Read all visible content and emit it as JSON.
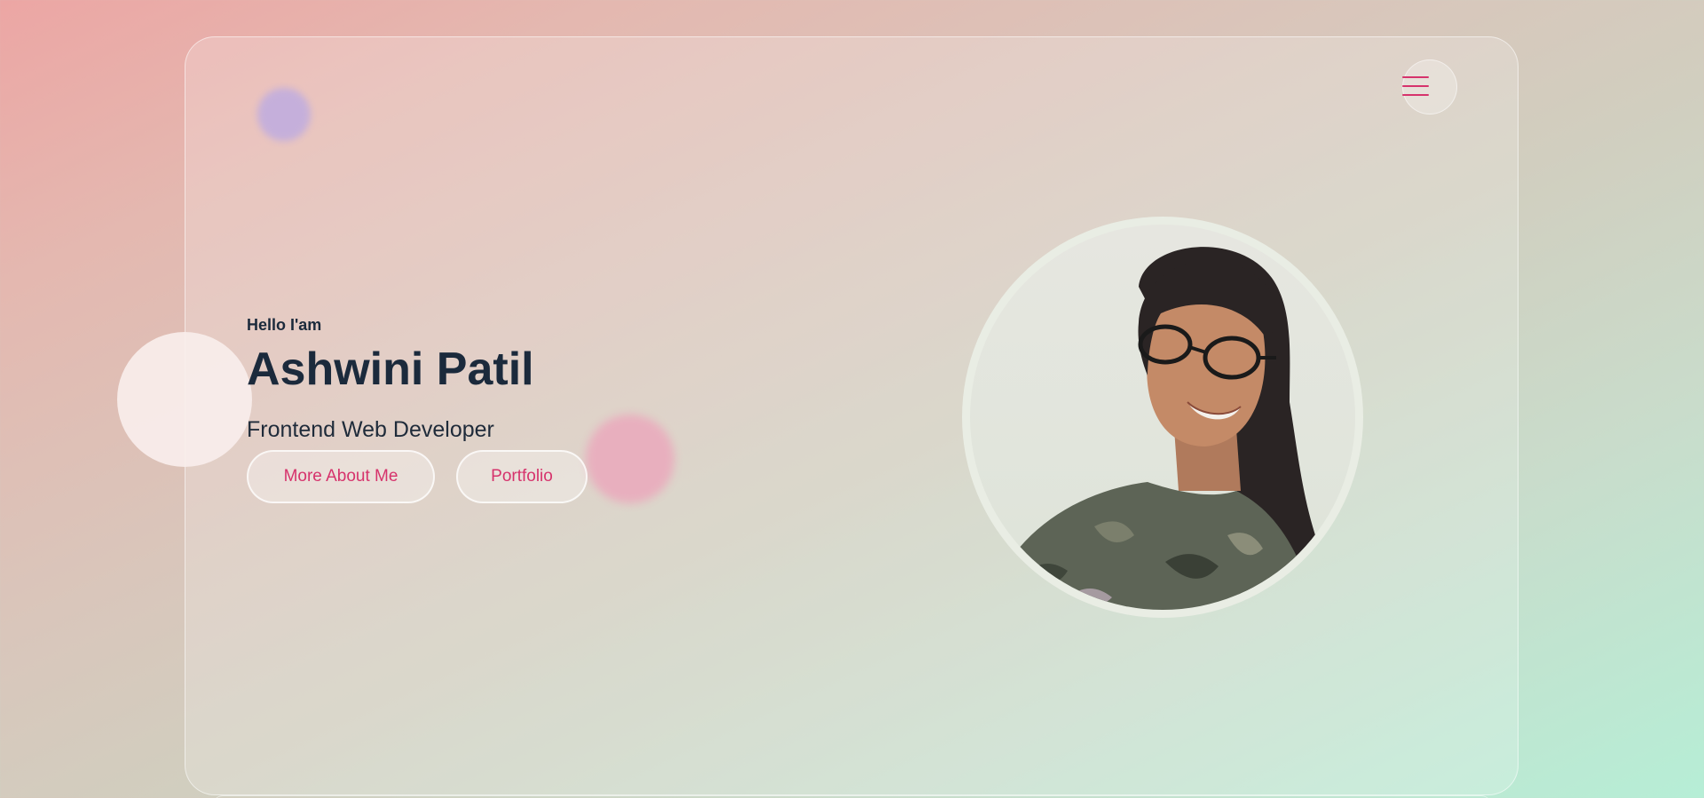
{
  "hero": {
    "greeting": "Hello I'am",
    "name": "Ashwini Patil",
    "role": "Frontend Web Developer",
    "buttons": {
      "more_about_me": "More About Me",
      "portfolio": "Portfolio"
    }
  },
  "nav": {
    "menu_icon": "hamburger-menu-icon"
  },
  "profile_photo": {
    "subject": "portrait-photo"
  },
  "colors": {
    "accent": "#d6336c",
    "text_dark": "#1b2a3c",
    "blob_purple": "#b39ad6",
    "blob_pink": "#e597ad"
  }
}
